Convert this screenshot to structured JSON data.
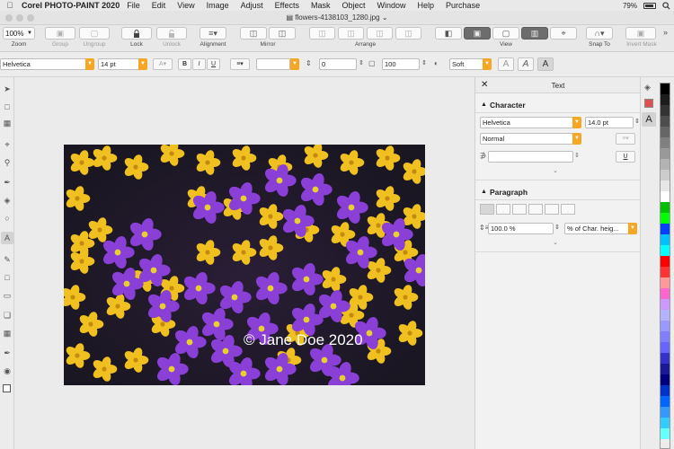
{
  "menubar": {
    "app_name": "Corel PHOTO-PAINT 2020",
    "items": [
      "File",
      "Edit",
      "View",
      "Image",
      "Adjust",
      "Effects",
      "Mask",
      "Object",
      "Window",
      "Help",
      "Purchase"
    ],
    "battery": "79%"
  },
  "window": {
    "title": "flowers-4138103_1280.jpg"
  },
  "toolbar": {
    "zoom_value": "100%",
    "labels": {
      "zoom": "Zoom",
      "group": "Group",
      "ungroup": "Ungroup",
      "lock": "Lock",
      "unlock": "Unlock",
      "alignment": "Alignment",
      "mirror": "Mirror",
      "arrange": "Arrange",
      "view": "View",
      "snap_to": "Snap To",
      "invert_mask": "Invert Mask"
    }
  },
  "propbar": {
    "font": "Helvetica",
    "size": "14 pt",
    "bold": "B",
    "italic": "I",
    "underline": "U",
    "spacing_value": "0",
    "opacity_value": "100",
    "antialias": "Soft",
    "style_a1": "A",
    "style_a2": "A"
  },
  "docker": {
    "title": "Text",
    "character": {
      "heading": "Character",
      "font": "Helvetica",
      "size": "14.0 pt",
      "style": "Normal",
      "underline_glyph": "U"
    },
    "paragraph": {
      "heading": "Paragraph",
      "spacing_value": "100.0 %",
      "spacing_unit": "% of Char. heig..."
    }
  },
  "canvas": {
    "watermark": "© Jane Doe 2020"
  },
  "colors": {
    "accent": "#f5a623",
    "flower_yellow": "#f0c020",
    "flower_purple": "#8a3fd6"
  },
  "palette": [
    "#000000",
    "#1c1c1c",
    "#333333",
    "#4d4d4d",
    "#666666",
    "#808080",
    "#999999",
    "#b3b3b3",
    "#cccccc",
    "#e6e6e6",
    "#ffffff",
    "#00c000",
    "#00ff00",
    "#0040ff",
    "#00c0ff",
    "#00ffff",
    "#ff0000",
    "#ff3333",
    "#ff9999",
    "#ff66cc",
    "#cc99ff",
    "#b3b3ff",
    "#9999ff",
    "#8080ff",
    "#6666ff",
    "#3333cc",
    "#1a1a99",
    "#000080",
    "#0033cc",
    "#0066ff",
    "#3399ff",
    "#33ccff",
    "#66ffff"
  ]
}
